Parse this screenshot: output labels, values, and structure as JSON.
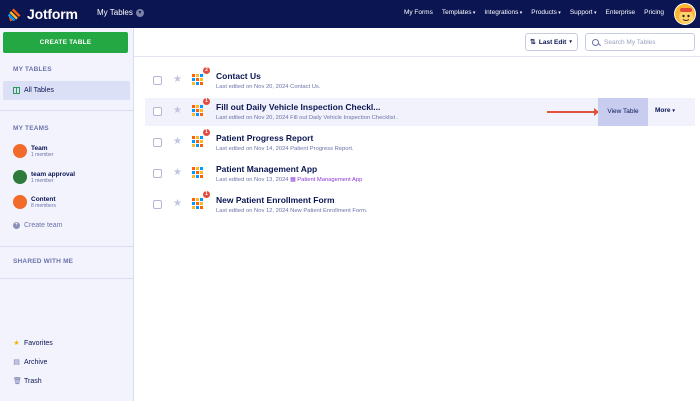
{
  "topbar": {
    "logo_text": "Jotform",
    "my_tables": "My Tables",
    "nav": [
      {
        "label": "My Forms",
        "caret": false
      },
      {
        "label": "Templates",
        "caret": true
      },
      {
        "label": "Integrations",
        "caret": true
      },
      {
        "label": "Products",
        "caret": true
      },
      {
        "label": "Support",
        "caret": true
      },
      {
        "label": "Enterprise",
        "caret": false
      },
      {
        "label": "Pricing",
        "caret": false
      }
    ]
  },
  "sidebar": {
    "create_label": "CREATE TABLE",
    "my_tables_title": "MY TABLES",
    "all_tables": "All Tables",
    "my_teams_title": "MY TEAMS",
    "teams": [
      {
        "name": "Team",
        "members": "1 member",
        "color": "#f26b2a"
      },
      {
        "name": "team approval",
        "members": "1 member",
        "color": "#2d7a3a"
      },
      {
        "name": "Content",
        "members": "8 members",
        "color": "#f26b2a"
      }
    ],
    "create_team": "Create team",
    "shared_title": "SHARED WITH ME",
    "favorites": "Favorites",
    "archive": "Archive",
    "trash": "Trash"
  },
  "toolbar": {
    "sort_label": "Last Edit",
    "search_placeholder": "Search My Tables"
  },
  "tables": [
    {
      "title": "Contact Us",
      "edited": "Last edited on Nov 20, 2024",
      "source": "Contact Us.",
      "badge": "2",
      "source_is_app": false
    },
    {
      "title": "Fill out Daily Vehicle Inspection Checkl...",
      "edited": "Last edited on Nov 20, 2024",
      "source": "Fill out Daily Vehicle Inspection Checklist .",
      "badge": "1",
      "source_is_app": false
    },
    {
      "title": "Patient Progress Report",
      "edited": "Last edited on Nov 14, 2024",
      "source": "Patient Progress Report.",
      "badge": "1",
      "source_is_app": false
    },
    {
      "title": "Patient Management App",
      "edited": "Last edited on Nov 13, 2024",
      "source": "Patient Management App",
      "badge": "",
      "source_is_app": true
    },
    {
      "title": "New Patient Enrollment Form",
      "edited": "Last edited on Nov 12, 2024",
      "source": "New Patient Enrollment Form.",
      "badge": "1",
      "source_is_app": false
    }
  ],
  "row_actions": {
    "view": "View Table",
    "more": "More"
  },
  "colors": {
    "topbar": "#0a1551",
    "create_button": "#23a843",
    "sidebar_bg": "#f3f3fe",
    "view_button": "#c8cdf0",
    "badge": "#e54b3c",
    "arrow": "#e0533a"
  }
}
